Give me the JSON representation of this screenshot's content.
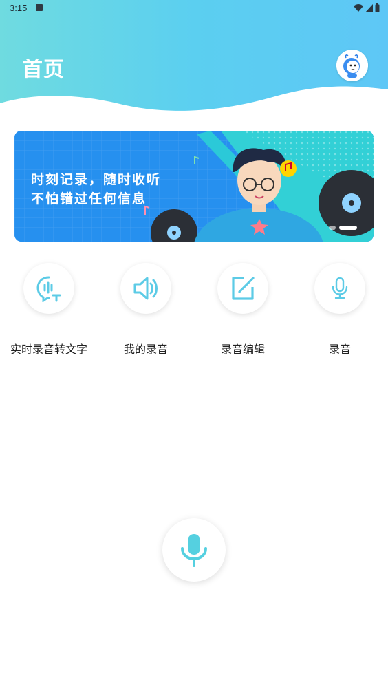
{
  "status_bar": {
    "time": "3:15"
  },
  "header": {
    "title": "首页",
    "gradient_from": "#5fd6e2",
    "gradient_to": "#56c3f4"
  },
  "banner": {
    "line1": "时刻记录，随时收听",
    "line2": "不怕错过任何信息"
  },
  "features": [
    {
      "label": "实时录音转文字",
      "icon": "voice-to-text-icon"
    },
    {
      "label": "我的录音",
      "icon": "speaker-icon"
    },
    {
      "label": "录音编辑",
      "icon": "edit-icon"
    },
    {
      "label": "录音",
      "icon": "microphone-icon"
    }
  ],
  "accent_color": "#56c9e6"
}
